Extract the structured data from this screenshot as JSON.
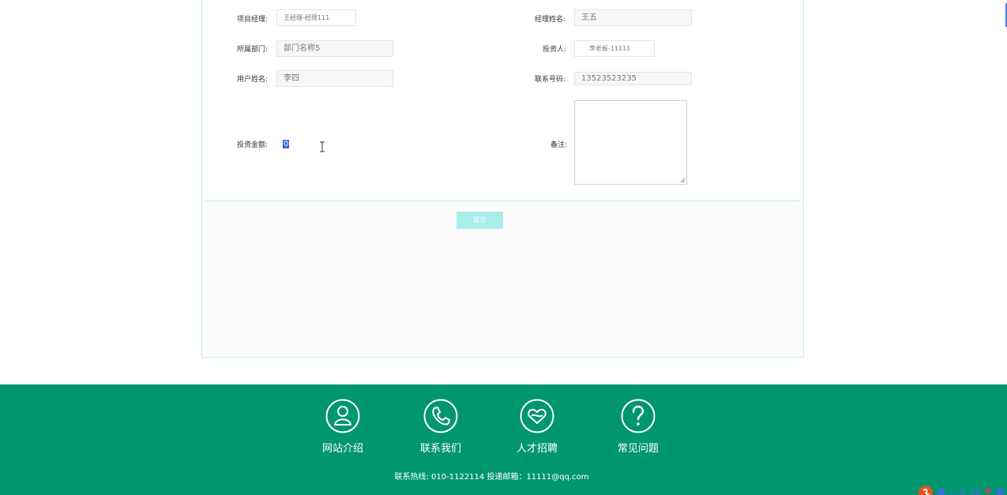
{
  "form": {
    "project_manager": {
      "label": "项目经理:",
      "value": "王经理-经理111"
    },
    "manager_name": {
      "label": "经理姓名:",
      "value": "王五"
    },
    "department": {
      "label": "所属部门:",
      "value": "部门名称5"
    },
    "investor": {
      "label": "投资人:",
      "value": "李老板-11111"
    },
    "user_name": {
      "label": "用户姓名:",
      "value": "李四"
    },
    "phone": {
      "label": "联系号码:",
      "value": "13523523235"
    },
    "amount": {
      "label": "投资金额:",
      "value": "0"
    },
    "remark": {
      "label": "备注:",
      "value": ""
    },
    "submit_label": "提交"
  },
  "footer": {
    "links": [
      {
        "label": "网站介绍",
        "icon": "person-icon"
      },
      {
        "label": "联系我们",
        "icon": "phone-icon"
      },
      {
        "label": "人才招聘",
        "icon": "heart-icon"
      },
      {
        "label": "常见问题",
        "icon": "question-icon"
      }
    ],
    "contact": "联系热线: 010-1122114 投递邮箱：11111@qq.com"
  },
  "colors": {
    "footer_bg": "#00966e",
    "submit_bg": "#a9efe9",
    "panel_border": "#bfeeea",
    "selection": "#3367d6"
  }
}
